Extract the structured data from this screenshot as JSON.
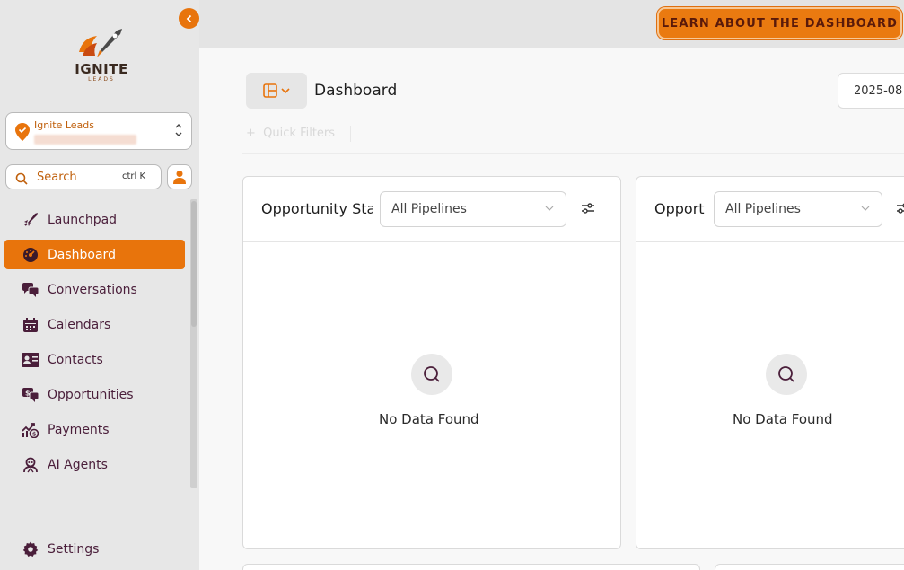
{
  "app": {
    "logo_text": "IGNITE",
    "logo_sub": "LEADS"
  },
  "account": {
    "name": "Ignite Leads"
  },
  "search": {
    "label": "Search",
    "shortcut": "ctrl K"
  },
  "nav": {
    "items": [
      {
        "label": "Launchpad",
        "icon": "rocket-icon"
      },
      {
        "label": "Dashboard",
        "icon": "gauge-icon",
        "active": true
      },
      {
        "label": "Conversations",
        "icon": "chat-icon"
      },
      {
        "label": "Calendars",
        "icon": "calendar-icon"
      },
      {
        "label": "Contacts",
        "icon": "contact-card-icon"
      },
      {
        "label": "Opportunities",
        "icon": "money-chat-icon"
      },
      {
        "label": "Payments",
        "icon": "payments-chart-icon"
      },
      {
        "label": "AI Agents",
        "icon": "robot-agent-icon"
      }
    ],
    "settings": "Settings"
  },
  "topbar": {
    "learn_button": "LEARN ABOUT THE DASHBOARD"
  },
  "main": {
    "title": "Dashboard",
    "date_value": "2025-08",
    "quick_filters": "Quick Filters",
    "cards": [
      {
        "title": "Opportunity Sta",
        "select_value": "All Pipelines",
        "empty_text": "No Data Found"
      },
      {
        "title": "Opport",
        "select_value": "All Pipelines",
        "empty_text": "No Data Found"
      }
    ]
  },
  "colors": {
    "accent": "#e8740c",
    "nav_text": "#4a1e3a"
  }
}
